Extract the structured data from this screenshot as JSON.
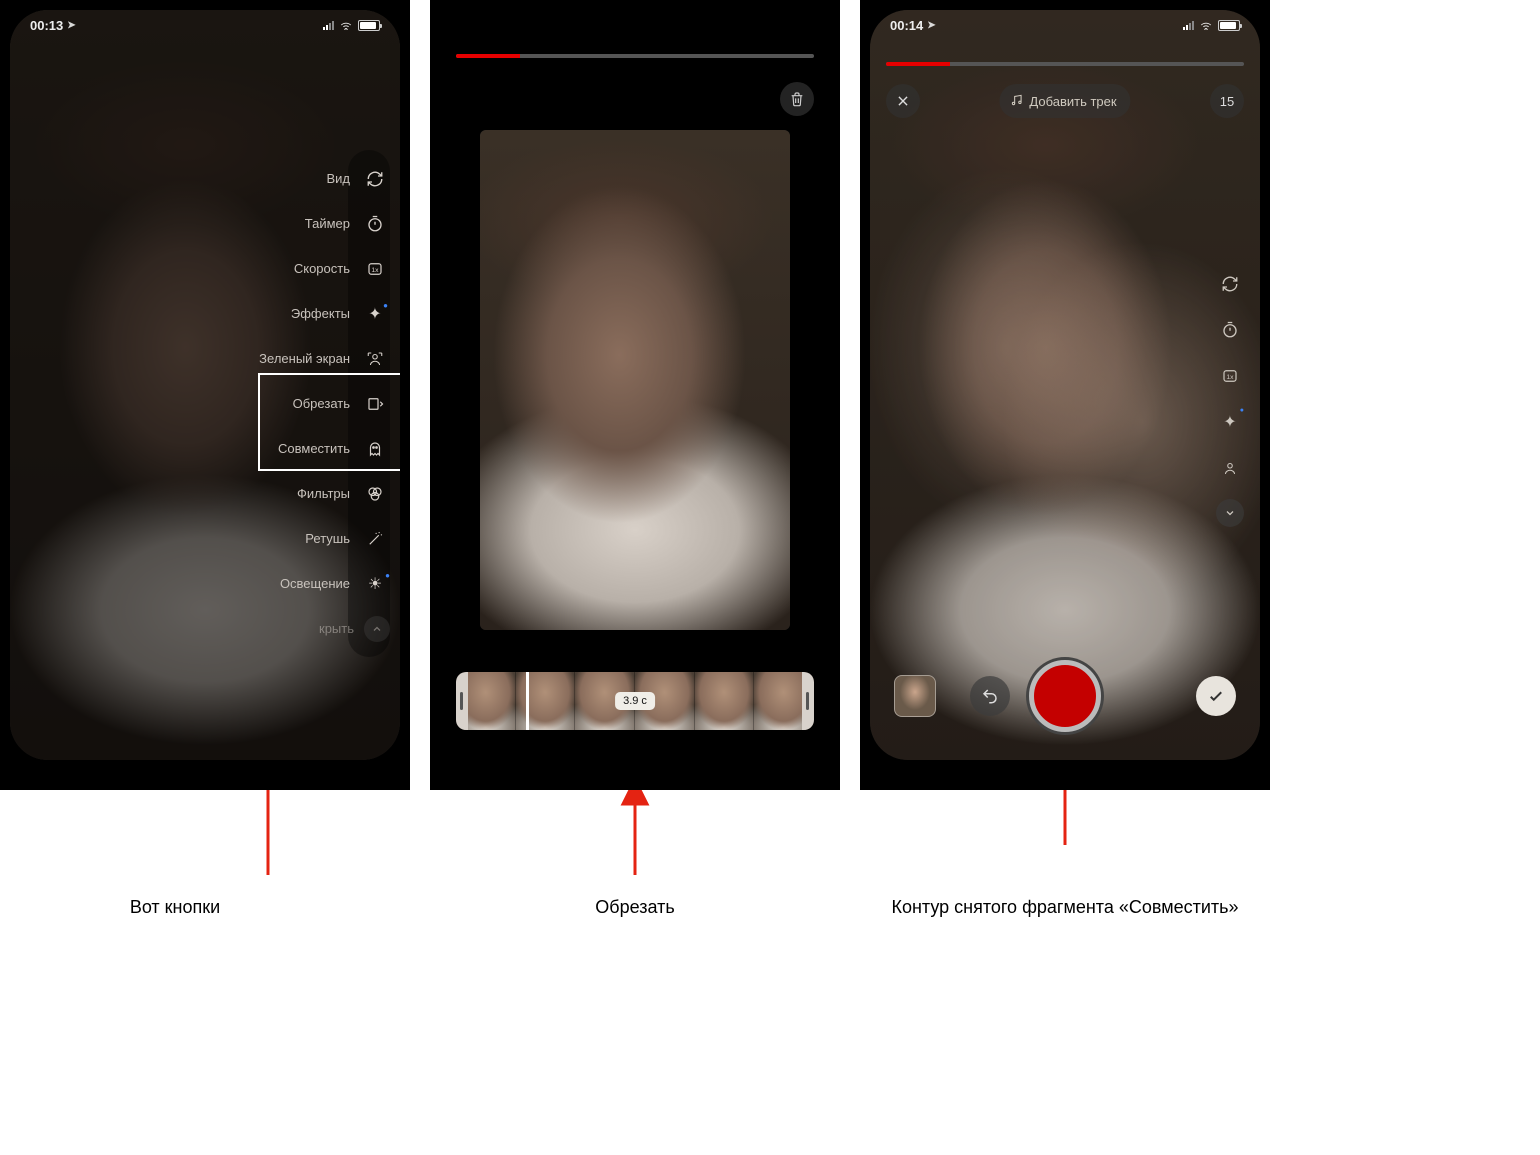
{
  "colors": {
    "accent_red": "#e42312",
    "record_red": "#c40000",
    "highlight_white": "#ffffff"
  },
  "captions": {
    "screen1": "Вот кнопки",
    "screen2": "Обрезать",
    "screen3": "Контур снятого фрагмента «Совместить»"
  },
  "screen1": {
    "time": "00:13",
    "battery_pct": 85,
    "tools": {
      "view": "Вид",
      "timer": "Таймер",
      "speed": "Скорость",
      "effects": "Эффекты",
      "green_screen": "Зеленый экран",
      "crop": "Обрезать",
      "combine": "Совместить",
      "filters": "Фильтры",
      "retouch": "Ретушь",
      "lighting": "Освещение",
      "hide": "крыть"
    }
  },
  "screen2": {
    "progress_pct": 18,
    "trim_time_label": "3.9 с",
    "frames_count": 6
  },
  "screen3": {
    "time": "00:14",
    "battery_pct": 85,
    "progress_pct": 18,
    "add_track_label": "Добавить трек",
    "remaining_badge": "15"
  }
}
